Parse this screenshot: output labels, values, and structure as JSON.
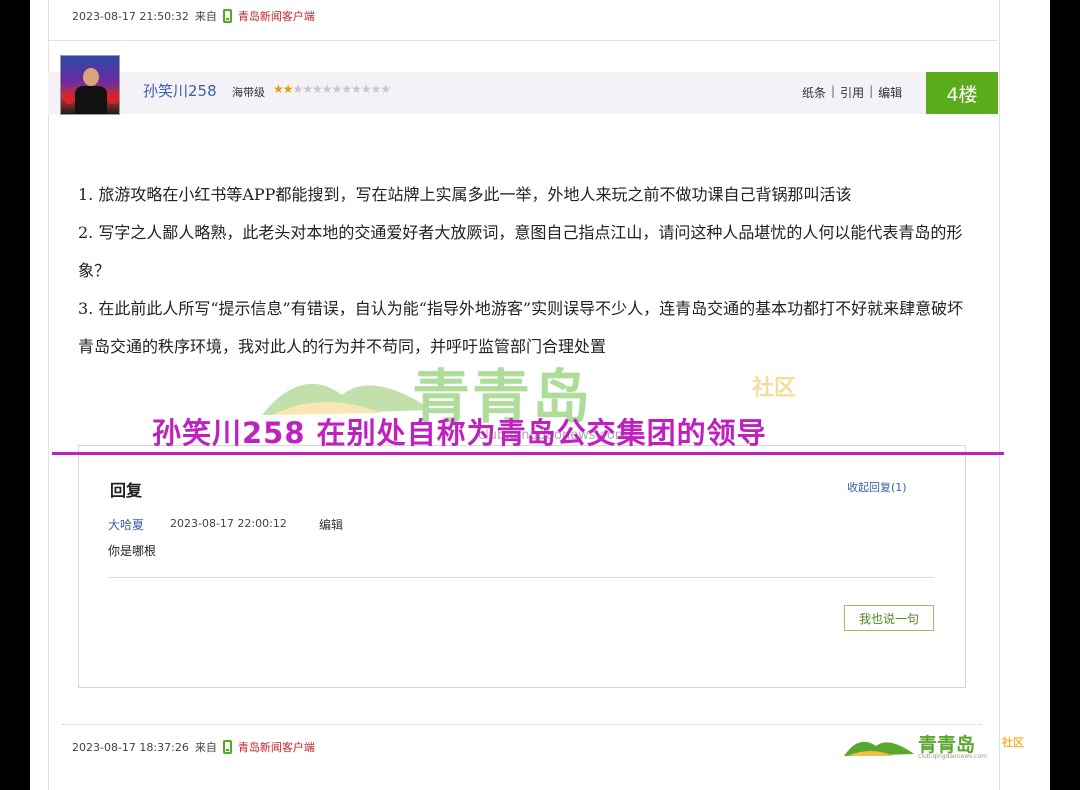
{
  "previous_post": {
    "timestamp": "2023-08-17 21:50:32",
    "from_label": "来自",
    "client_link": "青岛新闻客户端"
  },
  "post": {
    "username": "孙笑川258",
    "level_label": "海带级",
    "stars_filled": 2,
    "stars_total": 12,
    "actions": {
      "report": "纸条",
      "quote": "引用",
      "edit": "编辑"
    },
    "floor": "4楼",
    "paragraphs": [
      "1. 旅游攻略在小红书等APP都能搜到，写在站牌上实属多此一举，外地人来玩之前不做功课自己背锅那叫活该",
      "2. 写字之人鄙人略熟，此老头对本地的交通爱好者大放厥词，意图自己指点江山，请问这种人品堪忧的人何以能代表青岛的形象？",
      "3. 在此前此人所写“提示信息”有错误，自认为能“指导外地游客”实则误导不少人，连青岛交通的基本功都打不好就来肆意破坏青岛交通的秩序环境，我对此人的行为并不苟同，并呼吁监管部门合理处置"
    ],
    "timestamp": "2023-08-17 18:37:26",
    "from_label": "来自",
    "client_link": "青岛新闻客户端"
  },
  "overlay": {
    "caption": "孙笑川258  在别处自称为青岛公交集团的领导"
  },
  "watermark": {
    "brand": "青青岛",
    "sub": "社区",
    "url": "club.qingdaonews.com"
  },
  "reply_section": {
    "title": "回复",
    "collapse_label": "收起回复(1)",
    "replies": [
      {
        "user": "大哈夏",
        "time": "2023-08-17 22:00:12",
        "edit": "编辑",
        "content": "你是哪根"
      }
    ],
    "say_button": "我也说一句"
  },
  "colors": {
    "floor_badge": "#5aac1a",
    "link_blue": "#3c5fa8",
    "client_red": "#c0242b",
    "overlay_magenta": "#c020c0"
  }
}
